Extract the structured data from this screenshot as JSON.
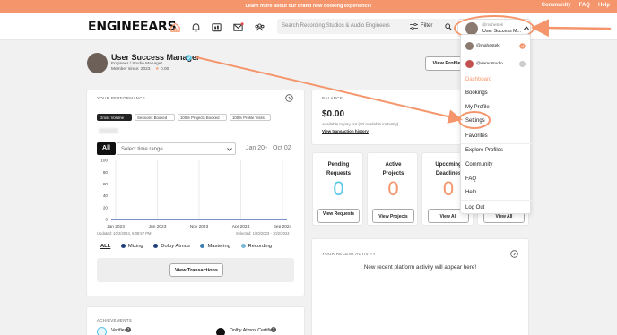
{
  "banner": {
    "promo": "Learn more about our brand new booking experience!",
    "links": [
      "Community",
      "FAQ",
      "Help"
    ]
  },
  "header": {
    "logo": "ENGINEEARS",
    "search_placeholder": "Search Recording Studios & Audio Engineers",
    "filter_label": "Filter",
    "user_handle": "@mahestek",
    "user_role": "User Success M..."
  },
  "profile": {
    "name": "User Success Manager",
    "subtitle": "Engineer / Studio Manager",
    "member_since": "Member since: 2023",
    "rating": "0.00",
    "view_profile": "View Profile"
  },
  "performance": {
    "title": "YOUR PERFORMANCE",
    "pills": [
      "Gross Volume",
      "Sessions Booked",
      "100% Projects Booked",
      "100% Profile Visits"
    ],
    "all_label": "All",
    "time_range_placeholder": "Select time range",
    "date_start": "Jan 20",
    "date_sep": "-",
    "date_end": "Oct 02",
    "updated": "Updated: 10/2/2024, 6:08:57 PM",
    "selected": "Selected: 1/20/2023 - 10/2/2024",
    "view_transactions": "View Transactions"
  },
  "chart_data": {
    "type": "line",
    "x": [
      "Jan 2023",
      "Jun 2023",
      "Nov 2023",
      "Apr 2024",
      "Sep 2024"
    ],
    "yticks": [
      0,
      20,
      40,
      60,
      80,
      100
    ],
    "ylim": [
      0,
      100
    ],
    "series": [
      {
        "values": [
          0,
          0,
          0,
          0,
          0
        ]
      }
    ],
    "grid": "vertical",
    "legend": [
      "ALL",
      "Mixing",
      "Dolby Atmos",
      "Mastering",
      "Recording"
    ],
    "legend_colors": [
      "#1f3f7a",
      "#1f3f7a",
      "#3d7fb0",
      "#7ab8d8"
    ]
  },
  "balance": {
    "title": "BALANCE",
    "amount": "$0.00",
    "note": "Available to pay out ($0 available instantly)",
    "history": "View transaction history"
  },
  "stats": [
    {
      "label1": "Pending",
      "label2": "Requests",
      "value": "0",
      "button": "View Requests"
    },
    {
      "label1": "Active",
      "label2": "Projects",
      "value": "0",
      "button": "View Projects"
    },
    {
      "label1": "Upcoming",
      "label2": "Deadlines",
      "value": "0",
      "button": "View All"
    },
    {
      "label1": "",
      "label2": "",
      "value": "",
      "button": "View All"
    }
  ],
  "activity": {
    "title": "YOUR RECENT ACTIVITY",
    "empty": "New recent platform activity will appear here!"
  },
  "achievements": {
    "title": "ACHIEVEMENTS",
    "items": [
      "Verified",
      "Dolby Atmos Certified"
    ]
  },
  "dropdown": {
    "accounts": [
      "@mahestek",
      "@demostudio"
    ],
    "items": [
      "Dashboard",
      "Bookings",
      "My Profile",
      "Settings",
      "Favorites",
      "Explore Profiles",
      "Community",
      "FAQ",
      "Help",
      "Log Out"
    ]
  },
  "colors": {
    "accent": "#f4956b",
    "blue": "#5bc6e8",
    "chart_line": "#2a4fa8"
  }
}
